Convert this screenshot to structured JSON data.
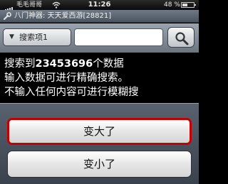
{
  "status_bar": {
    "carrier": "毛毛哥哥",
    "time": "11:26",
    "battery": "48 %"
  },
  "title_bar": {
    "icon": "wrench-icon",
    "title": "八门神器: 天天爱西游[28821]"
  },
  "search": {
    "dropdown_label": "搜索项1",
    "dropdown_icon": "triangle-down-icon",
    "input_value": "",
    "search_icon": "magnifier-icon"
  },
  "info": {
    "line1_prefix": "搜索到",
    "line1_count": "23453696",
    "line1_suffix": "个数据",
    "line2": "输入数据可进行精确搜索。",
    "line3": "不输入任何内容可进行模糊搜"
  },
  "action_sheet": {
    "option_bigger": "变大了",
    "option_smaller": "变小了"
  },
  "colors": {
    "selected_border": "#c40000",
    "titlebar": "#5a6470"
  }
}
